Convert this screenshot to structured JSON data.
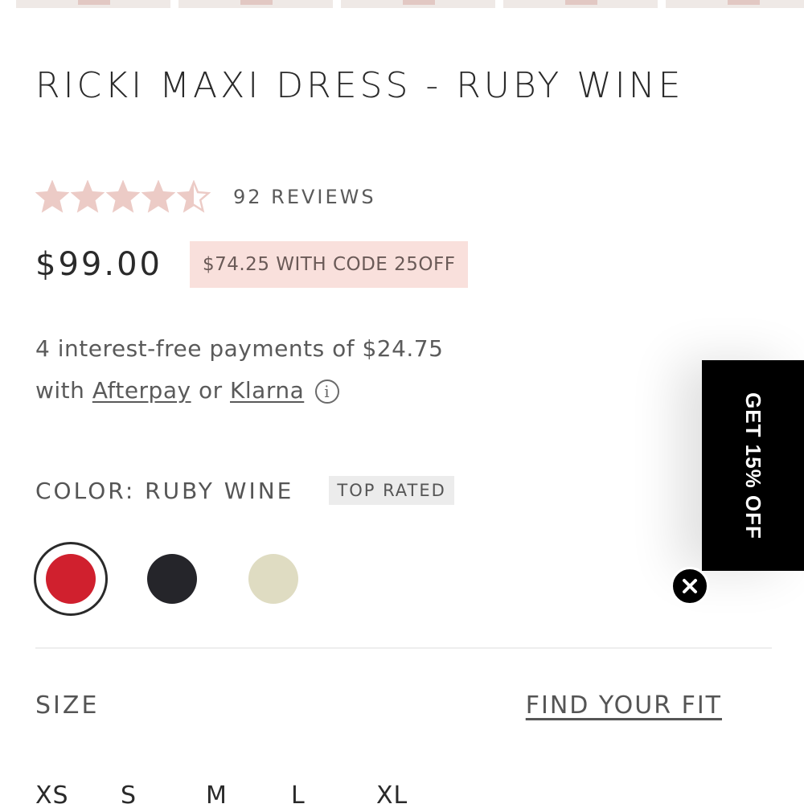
{
  "product": {
    "title": "RICKI MAXI DRESS - RUBY WINE",
    "rating": 4.5,
    "rating_max": 5,
    "reviews_label": "92 REVIEWS",
    "price": "$99.00",
    "promo_text": "$74.25 WITH CODE 25OFF",
    "installments": {
      "line1": "4 interest-free payments of $24.75",
      "with_text": "with",
      "afterpay_label": "Afterpay",
      "or_text": "or",
      "klarna_label": "Klarna",
      "info_glyph": "i"
    },
    "color": {
      "label": "COLOR: RUBY WINE",
      "badge": "TOP RATED",
      "swatches": [
        {
          "name": "Ruby Wine",
          "hex": "#d0202e",
          "selected": true
        },
        {
          "name": "Black",
          "hex": "#25252a",
          "selected": false
        },
        {
          "name": "Sage",
          "hex": "#dfdcc2",
          "selected": false
        }
      ]
    },
    "size": {
      "label": "SIZE",
      "fit_link": "FIND YOUR FIT",
      "options": [
        "XS",
        "S",
        "M",
        "L",
        "XL"
      ]
    }
  },
  "side_promo": {
    "label": "GET 15% OFF"
  },
  "colors": {
    "star_fill": "#eccbc6",
    "promo_bg": "#f9e0dc",
    "badge_bg": "#ececec"
  }
}
